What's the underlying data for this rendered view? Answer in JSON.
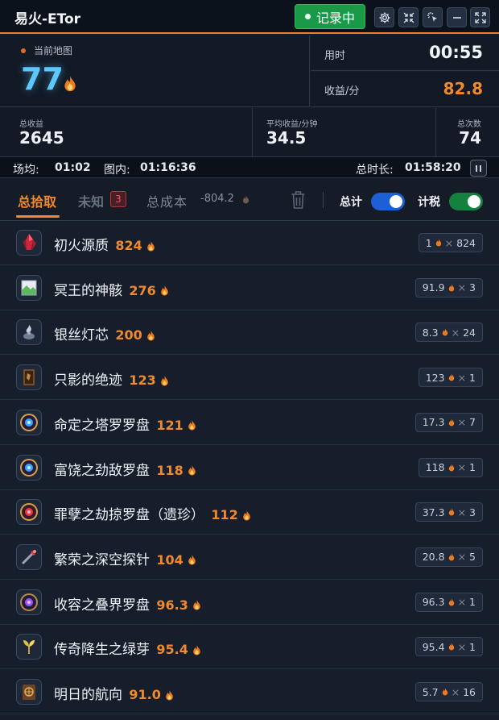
{
  "window": {
    "title": "易火-ETor",
    "record_label": "记录中"
  },
  "colors": {
    "accent": "#f08a2c",
    "map_number": "#5cc8ff",
    "record_green": "#1a9a48",
    "toggle_total": "#1d5fd6",
    "toggle_tax": "#16803f",
    "badge_red": "#f25560"
  },
  "current_map": {
    "label": "当前地图",
    "value": "77"
  },
  "time_used": {
    "label": "用时",
    "value": "00:55"
  },
  "income_rate": {
    "label": "收益/分",
    "value": "82.8"
  },
  "stats": {
    "total_income": {
      "label": "总收益",
      "value": "2645"
    },
    "avg_income": {
      "label": "平均收益/分钟",
      "value": "34.5"
    },
    "total_runs": {
      "label": "总次数",
      "value": "74"
    }
  },
  "times": {
    "field_label": "场均:",
    "field_value": "01:02",
    "in_map_label": "图内:",
    "in_map_value": "01:16:36",
    "total_label": "总时长:",
    "total_value": "01:58:20"
  },
  "tabs": {
    "pickup": "总拾取",
    "unknown": "未知",
    "unknown_count": "3",
    "total_cost": "总成本",
    "total_cost_value": "-804.2",
    "total_toggle": "总计",
    "tax_toggle": "计税"
  },
  "items": [
    {
      "name": "初火源质",
      "value": "824",
      "unit": "1",
      "count": "824",
      "icon": "red-crystal-icon"
    },
    {
      "name": "冥王的神骸",
      "value": "276",
      "unit": "91.9",
      "count": "3",
      "icon": "broken-image-icon"
    },
    {
      "name": "银丝灯芯",
      "value": "200",
      "unit": "8.3",
      "count": "24",
      "icon": "silver-wick-icon"
    },
    {
      "name": "只影的绝迹",
      "value": "123",
      "unit": "123",
      "count": "1",
      "icon": "card-icon"
    },
    {
      "name": "命定之塔罗罗盘",
      "value": "121",
      "unit": "17.3",
      "count": "7",
      "icon": "blue-compass-icon"
    },
    {
      "name": "富饶之劲敌罗盘",
      "value": "118",
      "unit": "118",
      "count": "1",
      "icon": "blue-compass-icon"
    },
    {
      "name": "罪孽之劫掠罗盘（遗珍）",
      "value": "112",
      "unit": "37.3",
      "count": "3",
      "icon": "red-compass-icon"
    },
    {
      "name": "繁荣之深空探针",
      "value": "104",
      "unit": "20.8",
      "count": "5",
      "icon": "probe-icon"
    },
    {
      "name": "收容之叠界罗盘",
      "value": "96.3",
      "unit": "96.3",
      "count": "1",
      "icon": "purple-compass-icon"
    },
    {
      "name": "传奇降生之绿芽",
      "value": "95.4",
      "unit": "95.4",
      "count": "1",
      "icon": "green-sprout-icon"
    },
    {
      "name": "明日的航向",
      "value": "91.0",
      "unit": "5.7",
      "count": "16",
      "icon": "tome-icon"
    }
  ]
}
